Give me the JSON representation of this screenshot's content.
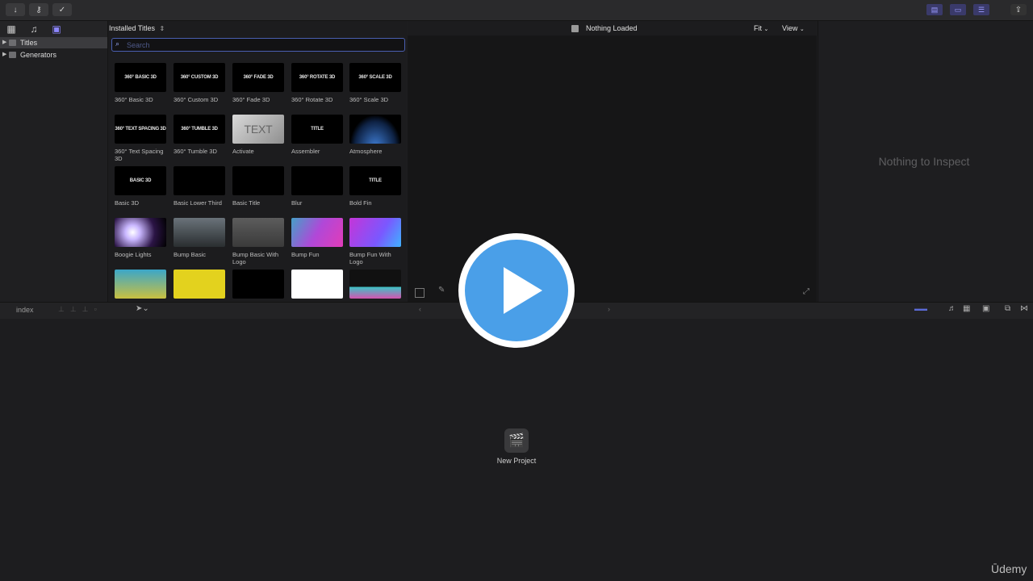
{
  "toolbar": {
    "import_icon": "download-arrow",
    "keywords_icon": "key",
    "background_tasks_icon": "check-circle"
  },
  "sidebar": {
    "items": [
      {
        "label": "Titles",
        "selected": true
      },
      {
        "label": "Generators",
        "selected": false
      }
    ]
  },
  "browser": {
    "header": "Installed Titles",
    "search_placeholder": "Search",
    "tiles": [
      {
        "name": "360° Basic 3D",
        "thumb_text": "360° BASIC 3D"
      },
      {
        "name": "360° Custom 3D",
        "thumb_text": "360° CUSTOM 3D"
      },
      {
        "name": "360° Fade 3D",
        "thumb_text": "360° FADE 3D"
      },
      {
        "name": "360° Rotate 3D",
        "thumb_text": "360° ROTATE 3D"
      },
      {
        "name": "360° Scale 3D",
        "thumb_text": "360° SCALE 3D"
      },
      {
        "name": "360° Text Spacing 3D",
        "thumb_text": "360° TEXT SPACING 3D"
      },
      {
        "name": "360° Tumble 3D",
        "thumb_text": "360° TUMBLE 3D"
      },
      {
        "name": "Activate",
        "thumb_text": "TEXT"
      },
      {
        "name": "Assembler",
        "thumb_text": "TITLE"
      },
      {
        "name": "Atmosphere",
        "thumb_text": ""
      },
      {
        "name": "Basic 3D",
        "thumb_text": "BASIC 3D"
      },
      {
        "name": "Basic Lower Third",
        "thumb_text": ""
      },
      {
        "name": "Basic Title",
        "thumb_text": ""
      },
      {
        "name": "Blur",
        "thumb_text": ""
      },
      {
        "name": "Bold Fin",
        "thumb_text": "TITLE"
      },
      {
        "name": "Boogie Lights",
        "thumb_text": ""
      },
      {
        "name": "Bump Basic",
        "thumb_text": ""
      },
      {
        "name": "Bump Basic With Logo",
        "thumb_text": ""
      },
      {
        "name": "Bump Fun",
        "thumb_text": ""
      },
      {
        "name": "Bump Fun With Logo",
        "thumb_text": ""
      },
      {
        "name": "",
        "thumb_text": ""
      },
      {
        "name": "",
        "thumb_text": ""
      },
      {
        "name": "",
        "thumb_text": ""
      },
      {
        "name": "",
        "thumb_text": ""
      },
      {
        "name": "",
        "thumb_text": ""
      }
    ]
  },
  "viewer": {
    "status": "Nothing Loaded",
    "fit_label": "Fit",
    "view_label": "View"
  },
  "inspector": {
    "empty_text": "Nothing to Inspect"
  },
  "timeline": {
    "index_label": "index",
    "new_project_label": "New Project"
  },
  "watermark": "Ūdemy",
  "colors": {
    "play_button": "#4a9fe8",
    "search_border": "#4a5fb0",
    "accent": "#5b6bd6"
  }
}
